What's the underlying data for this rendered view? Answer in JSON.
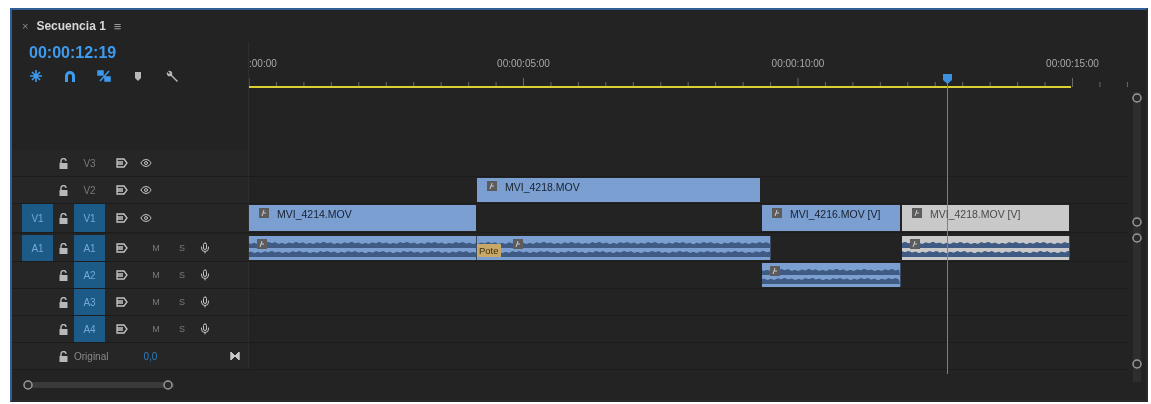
{
  "sequence_tab": {
    "close": "×",
    "title": "Secuencia 1",
    "menu": "≡"
  },
  "timecode": "00:00:12:19",
  "tools": [
    {
      "kind": "snap",
      "on": true
    },
    {
      "kind": "magnet",
      "on": true
    },
    {
      "kind": "linked",
      "on": true
    },
    {
      "kind": "marker",
      "on": false
    },
    {
      "kind": "wrench",
      "on": false
    }
  ],
  "ruler": {
    "labels": [
      ":00:00",
      "00:00:05:00",
      "00:00:10:00",
      "00:00:15:00"
    ]
  },
  "tracks": [
    {
      "name": "V3",
      "kind": "video",
      "targeted": false
    },
    {
      "name": "V2",
      "kind": "video",
      "targeted": false,
      "clips": [
        {
          "kind": "video",
          "name": "MVI_4218.MOV",
          "disabled": false
        }
      ]
    },
    {
      "name": "V1",
      "kind": "video",
      "targeted": true,
      "source": "V1",
      "clips": [
        {
          "kind": "video",
          "name": "MVI_4214.MOV",
          "disabled": false
        },
        {
          "kind": "video",
          "name": "MVI_4216.MOV [V]",
          "disabled": false
        },
        {
          "kind": "video",
          "name": "MVI_4218.MOV [V]",
          "disabled": true
        }
      ]
    },
    {
      "name": "A1",
      "kind": "audio",
      "targeted": true,
      "source": "A1",
      "mute": "M",
      "solo": "S",
      "clips": [
        {
          "kind": "audio",
          "disabled": false
        },
        {
          "kind": "audio",
          "disabled": false,
          "label": "Pote"
        },
        {
          "kind": "audio",
          "disabled": true
        }
      ]
    },
    {
      "name": "A2",
      "kind": "audio",
      "targeted": true,
      "mute": "M",
      "solo": "S",
      "clips": [
        {
          "kind": "audio",
          "disabled": false
        }
      ]
    },
    {
      "name": "A3",
      "kind": "audio",
      "targeted": true,
      "mute": "M",
      "solo": "S"
    },
    {
      "name": "A4",
      "kind": "audio",
      "targeted": true,
      "mute": "M",
      "solo": "S"
    }
  ],
  "master": {
    "label": "Original",
    "value": "0,0"
  }
}
